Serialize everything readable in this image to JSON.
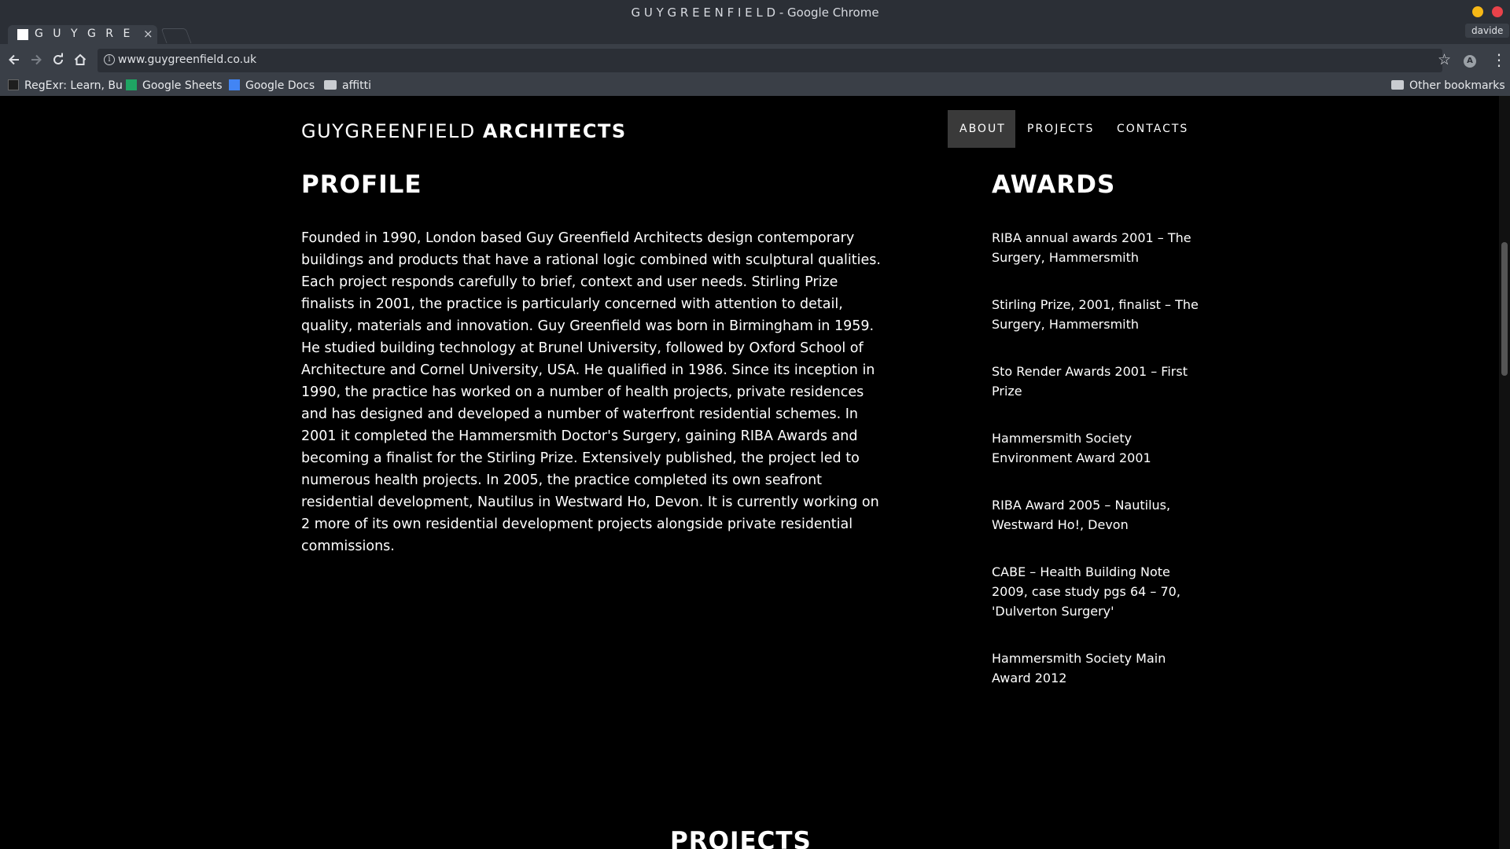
{
  "window": {
    "title": "G U Y G R E E N F I E L D - Google Chrome",
    "profile": "davide"
  },
  "tab": {
    "title": "G U Y G R E E N F I E L D",
    "close": "×"
  },
  "toolbar": {
    "url": "www.guygreenfield.co.uk"
  },
  "bookmarks": [
    {
      "label": "RegExr: Learn, Bu",
      "icon": "regexr-icon"
    },
    {
      "label": "Google Sheets",
      "icon": "sheets-icon"
    },
    {
      "label": "Google Docs",
      "icon": "docs-icon"
    },
    {
      "label": "affitti",
      "icon": "folder-icon"
    }
  ],
  "other_bookmarks": "Other bookmarks",
  "site": {
    "logo_light": "GUYGREENFIELD",
    "logo_bold": "ARCHITECTS",
    "nav": [
      {
        "label": "ABOUT",
        "active": true
      },
      {
        "label": "PROJECTS",
        "active": false
      },
      {
        "label": "CONTACTS",
        "active": false
      }
    ]
  },
  "profile": {
    "heading": "PROFILE",
    "text": "Founded in 1990, London based Guy Greenfield Architects design contemporary buildings and products that have a rational logic combined with sculptural qualities. Each project responds carefully to brief, context and user needs. Stirling Prize finalists in 2001, the practice is particularly concerned with attention to detail, quality, materials and innovation. Guy Greenfield was born in Birmingham in 1959. He studied building technology at Brunel University, followed by Oxford School of Architecture and Cornel University, USA. He qualified in 1986. Since its inception in 1990, the practice has worked on a number of health projects, private residences and has designed and developed a number of waterfront residential schemes. In 2001 it completed the Hammersmith Doctor's Surgery, gaining RIBA Awards and becoming a finalist for the Stirling Prize. Extensively published, the project led to numerous health projects. In 2005, the practice completed its own seafront residential development, Nautilus in Westward Ho, Devon. It is currently working on 2 more of its own residential development projects alongside private residential commissions."
  },
  "awards": {
    "heading": "AWARDS",
    "items": [
      "RIBA annual awards 2001 – The Surgery, Hammersmith",
      "Stirling Prize, 2001, finalist – The Surgery, Hammersmith",
      "Sto Render Awards 2001 – First Prize",
      "Hammersmith Society Environment Award 2001",
      "RIBA Award 2005 – Nautilus, Westward Ho!, Devon",
      "CABE – Health Building Note 2009, case study pgs 64 – 70, 'Dulverton Surgery'",
      "Hammersmith Society Main Award 2012"
    ]
  },
  "projects": {
    "heading": "PROJECTS"
  }
}
